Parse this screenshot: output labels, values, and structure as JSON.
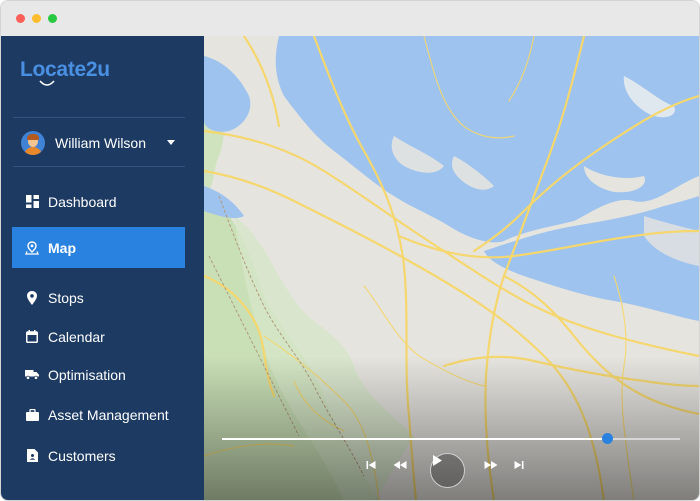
{
  "window": {
    "controls": [
      "close",
      "minimize",
      "maximize"
    ]
  },
  "brand": {
    "logo_text": "Locate2u",
    "accent": "#4a90e2"
  },
  "user": {
    "name": "William Wilson",
    "avatar_icon": "user-avatar-icon"
  },
  "nav": {
    "items": [
      {
        "label": "Dashboard",
        "icon": "dashboard-icon",
        "active": false
      },
      {
        "label": "Map",
        "icon": "map-pin-icon",
        "active": true
      },
      {
        "label": "Stops",
        "icon": "location-pin-icon",
        "active": false
      },
      {
        "label": "Calendar",
        "icon": "calendar-icon",
        "active": false
      },
      {
        "label": "Optimisation",
        "icon": "truck-icon",
        "active": false
      },
      {
        "label": "Asset Management",
        "icon": "briefcase-icon",
        "active": false
      },
      {
        "label": "Customers",
        "icon": "contact-card-icon",
        "active": false
      }
    ],
    "active_color": "#2a82e0",
    "sidebar_color": "#1d3a63"
  },
  "playback": {
    "progress": 0.84,
    "buttons": [
      "skip-back",
      "rewind",
      "play",
      "fast-forward",
      "skip-forward"
    ]
  },
  "map": {
    "water_color": "#9dc3ee",
    "land_color": "#e6e4df",
    "road_color": "#f5d76e",
    "park_color": "#c9dfb6"
  }
}
